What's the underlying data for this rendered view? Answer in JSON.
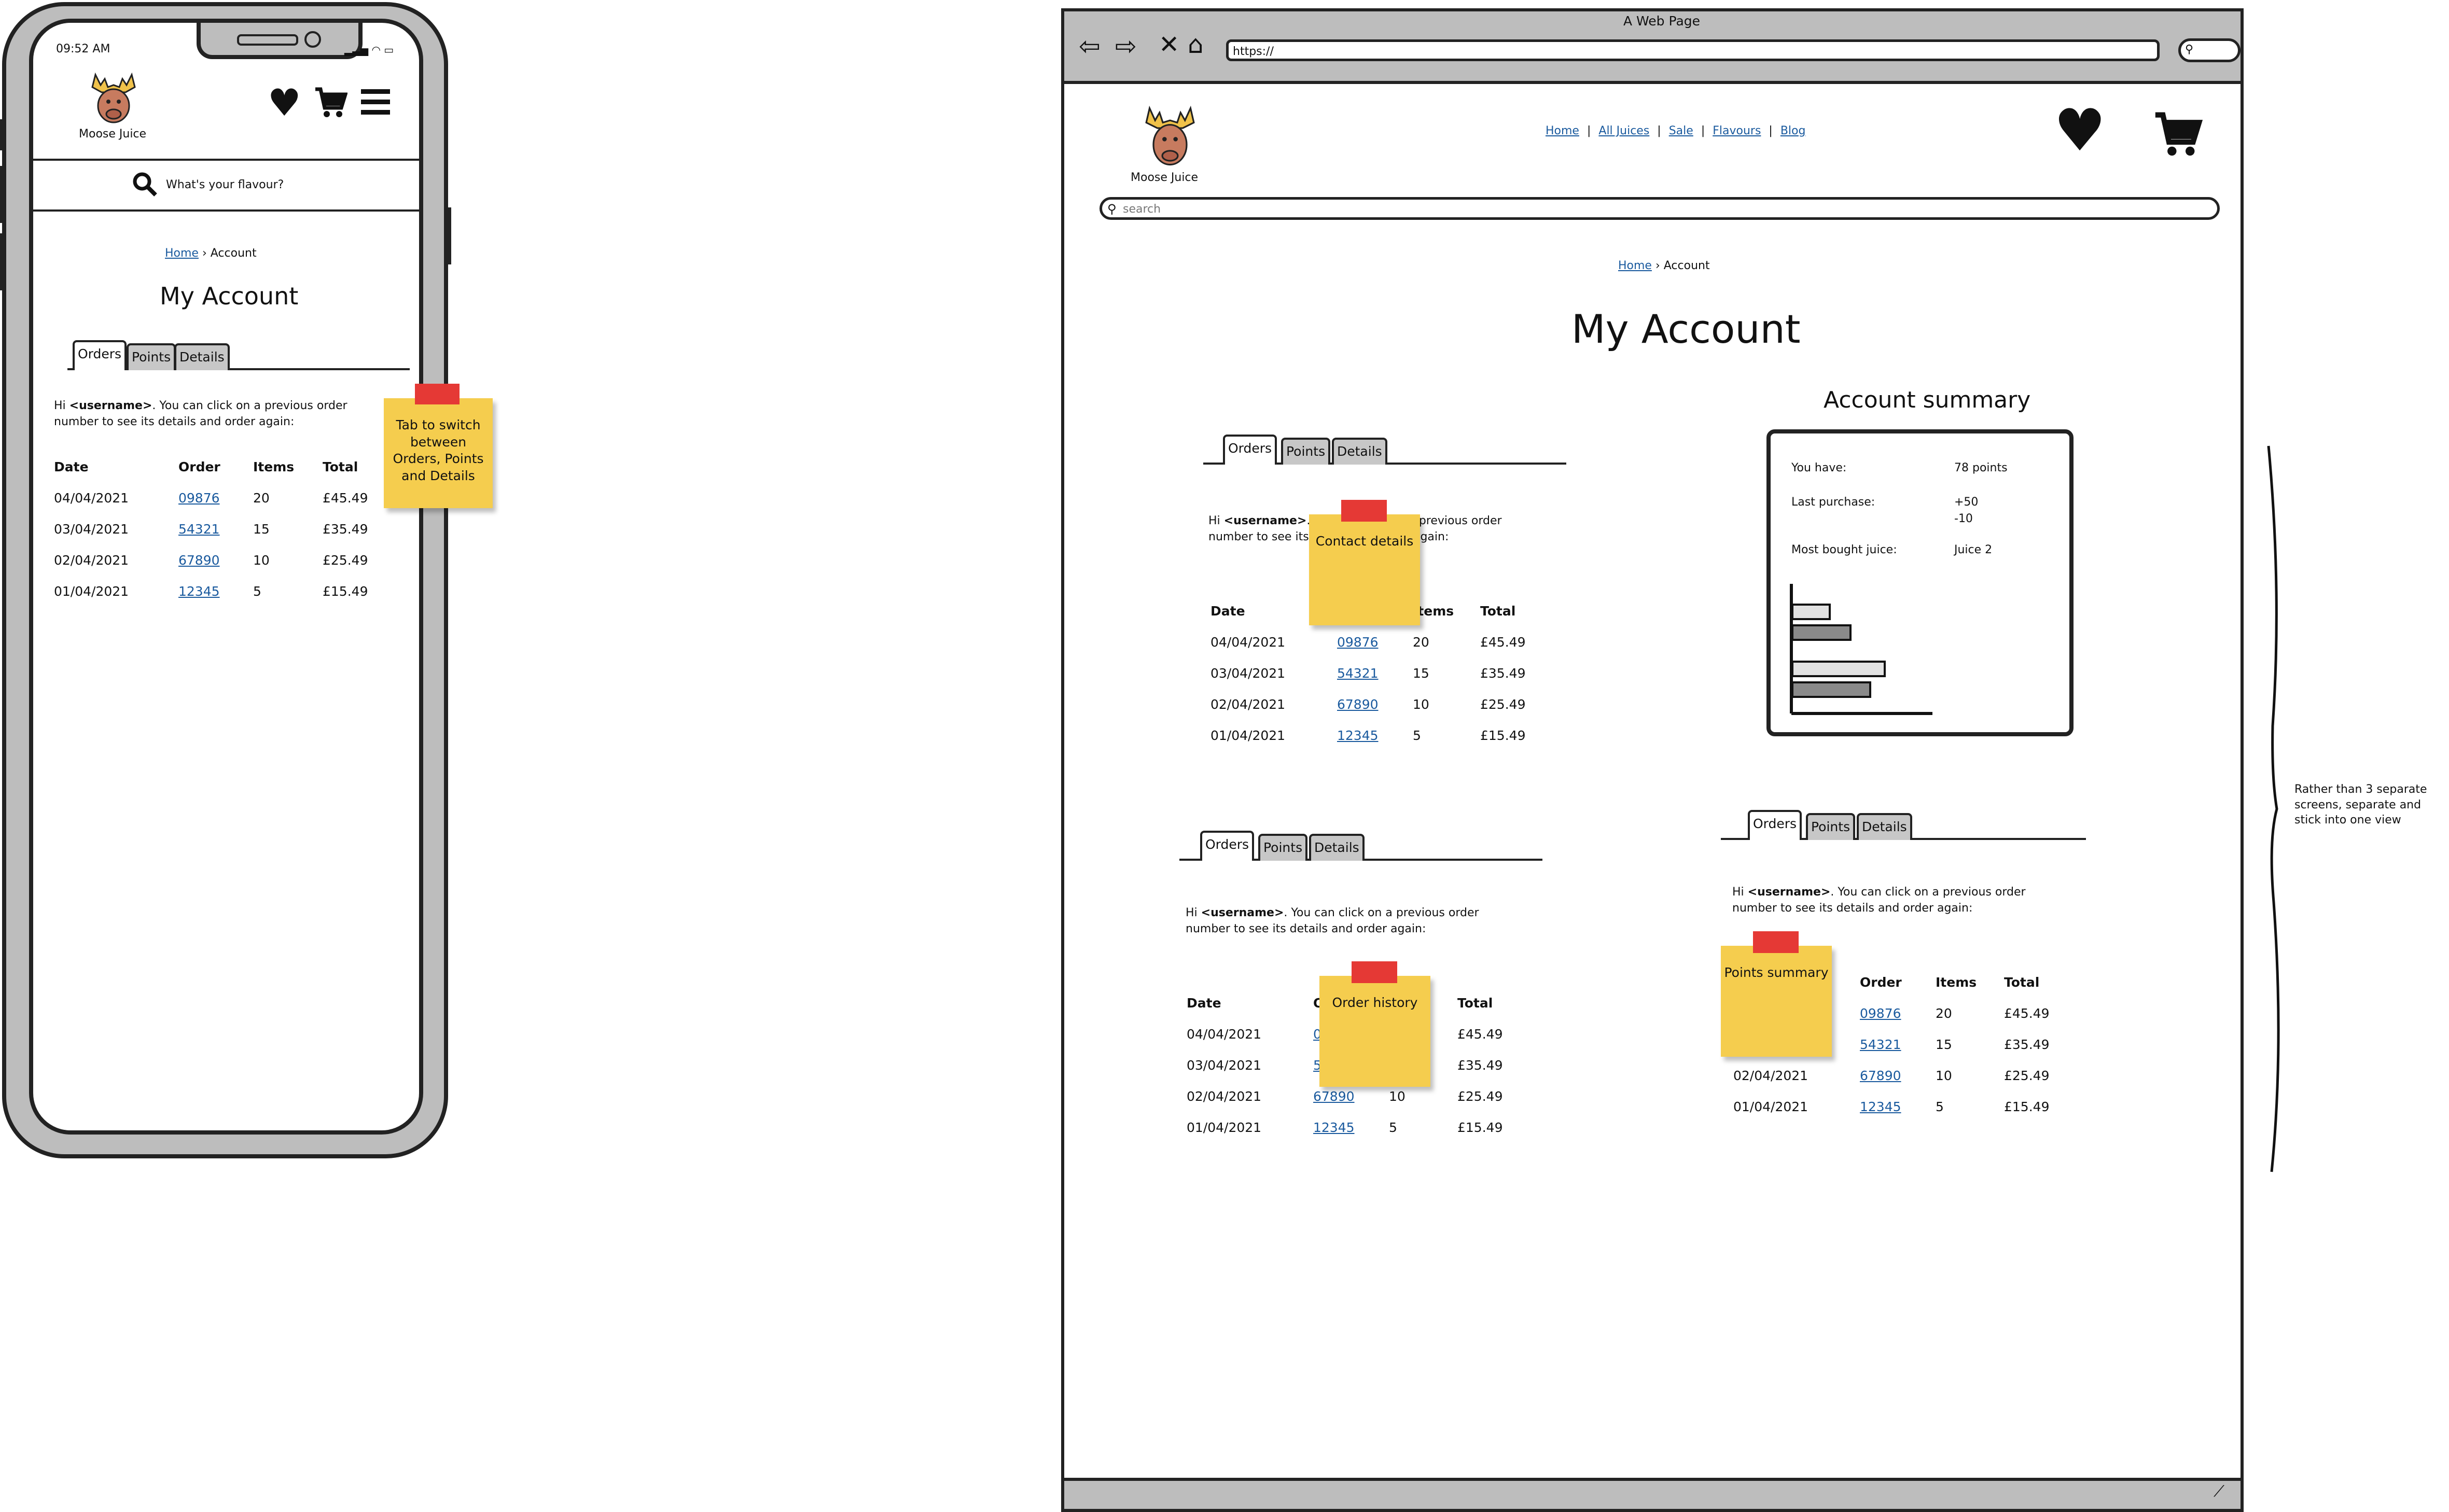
{
  "brand": {
    "name": "Moose Juice"
  },
  "phone": {
    "status_time": "09:52 AM",
    "search_placeholder": "What's your flavour?",
    "breadcrumb": {
      "home": "Home",
      "current": "Account"
    },
    "title": "My Account",
    "tabs": [
      "Orders",
      "Points",
      "Details"
    ],
    "intro_prefix": "Hi ",
    "intro_user": "<username>",
    "intro_suffix": ". You can click on a previous order number to see its details and order again:",
    "note": "Tab to switch between Orders, Points and Details"
  },
  "browser": {
    "window_title": "A Web Page",
    "url": "https://",
    "nav": [
      "Home",
      "All Juices",
      "Sale",
      "Flavours",
      "Blog"
    ],
    "search_placeholder": "search",
    "breadcrumb": {
      "home": "Home",
      "current": "Account"
    },
    "title": "My Account",
    "tabs": [
      "Orders",
      "Points",
      "Details"
    ],
    "intro_prefix": "Hi ",
    "intro_user": "<username>",
    "intro_suffix": ". You can click on a previous order number to see its details and order again:",
    "summary": {
      "title": "Account summary",
      "you_have_label": "You have:",
      "you_have_value": "78 points",
      "last_purchase_label": "Last purchase:",
      "last_purchase_plus": "+50",
      "last_purchase_minus": "-10",
      "most_bought_label": "Most bought juice:",
      "most_bought_value": "Juice 2"
    },
    "notes": {
      "contact": "Contact details",
      "order_history": "Order history",
      "points_summary": "Points summary"
    }
  },
  "orders": {
    "headers": [
      "Date",
      "Order",
      "Items",
      "Total"
    ],
    "rows": [
      [
        "04/04/2021",
        "09876",
        "20",
        "£45.49"
      ],
      [
        "03/04/2021",
        "54321",
        "15",
        "£35.49"
      ],
      [
        "02/04/2021",
        "67890",
        "10",
        "£25.49"
      ],
      [
        "01/04/2021",
        "12345",
        "5",
        "£15.49"
      ]
    ]
  },
  "annotation": "Rather than 3 separate screens, separate and stick into one view",
  "icons": [
    "moose-logo-icon",
    "heart-icon",
    "cart-icon",
    "menu-icon",
    "search-icon",
    "back-icon",
    "forward-icon",
    "close-icon",
    "home-icon",
    "resize-grip-icon"
  ]
}
